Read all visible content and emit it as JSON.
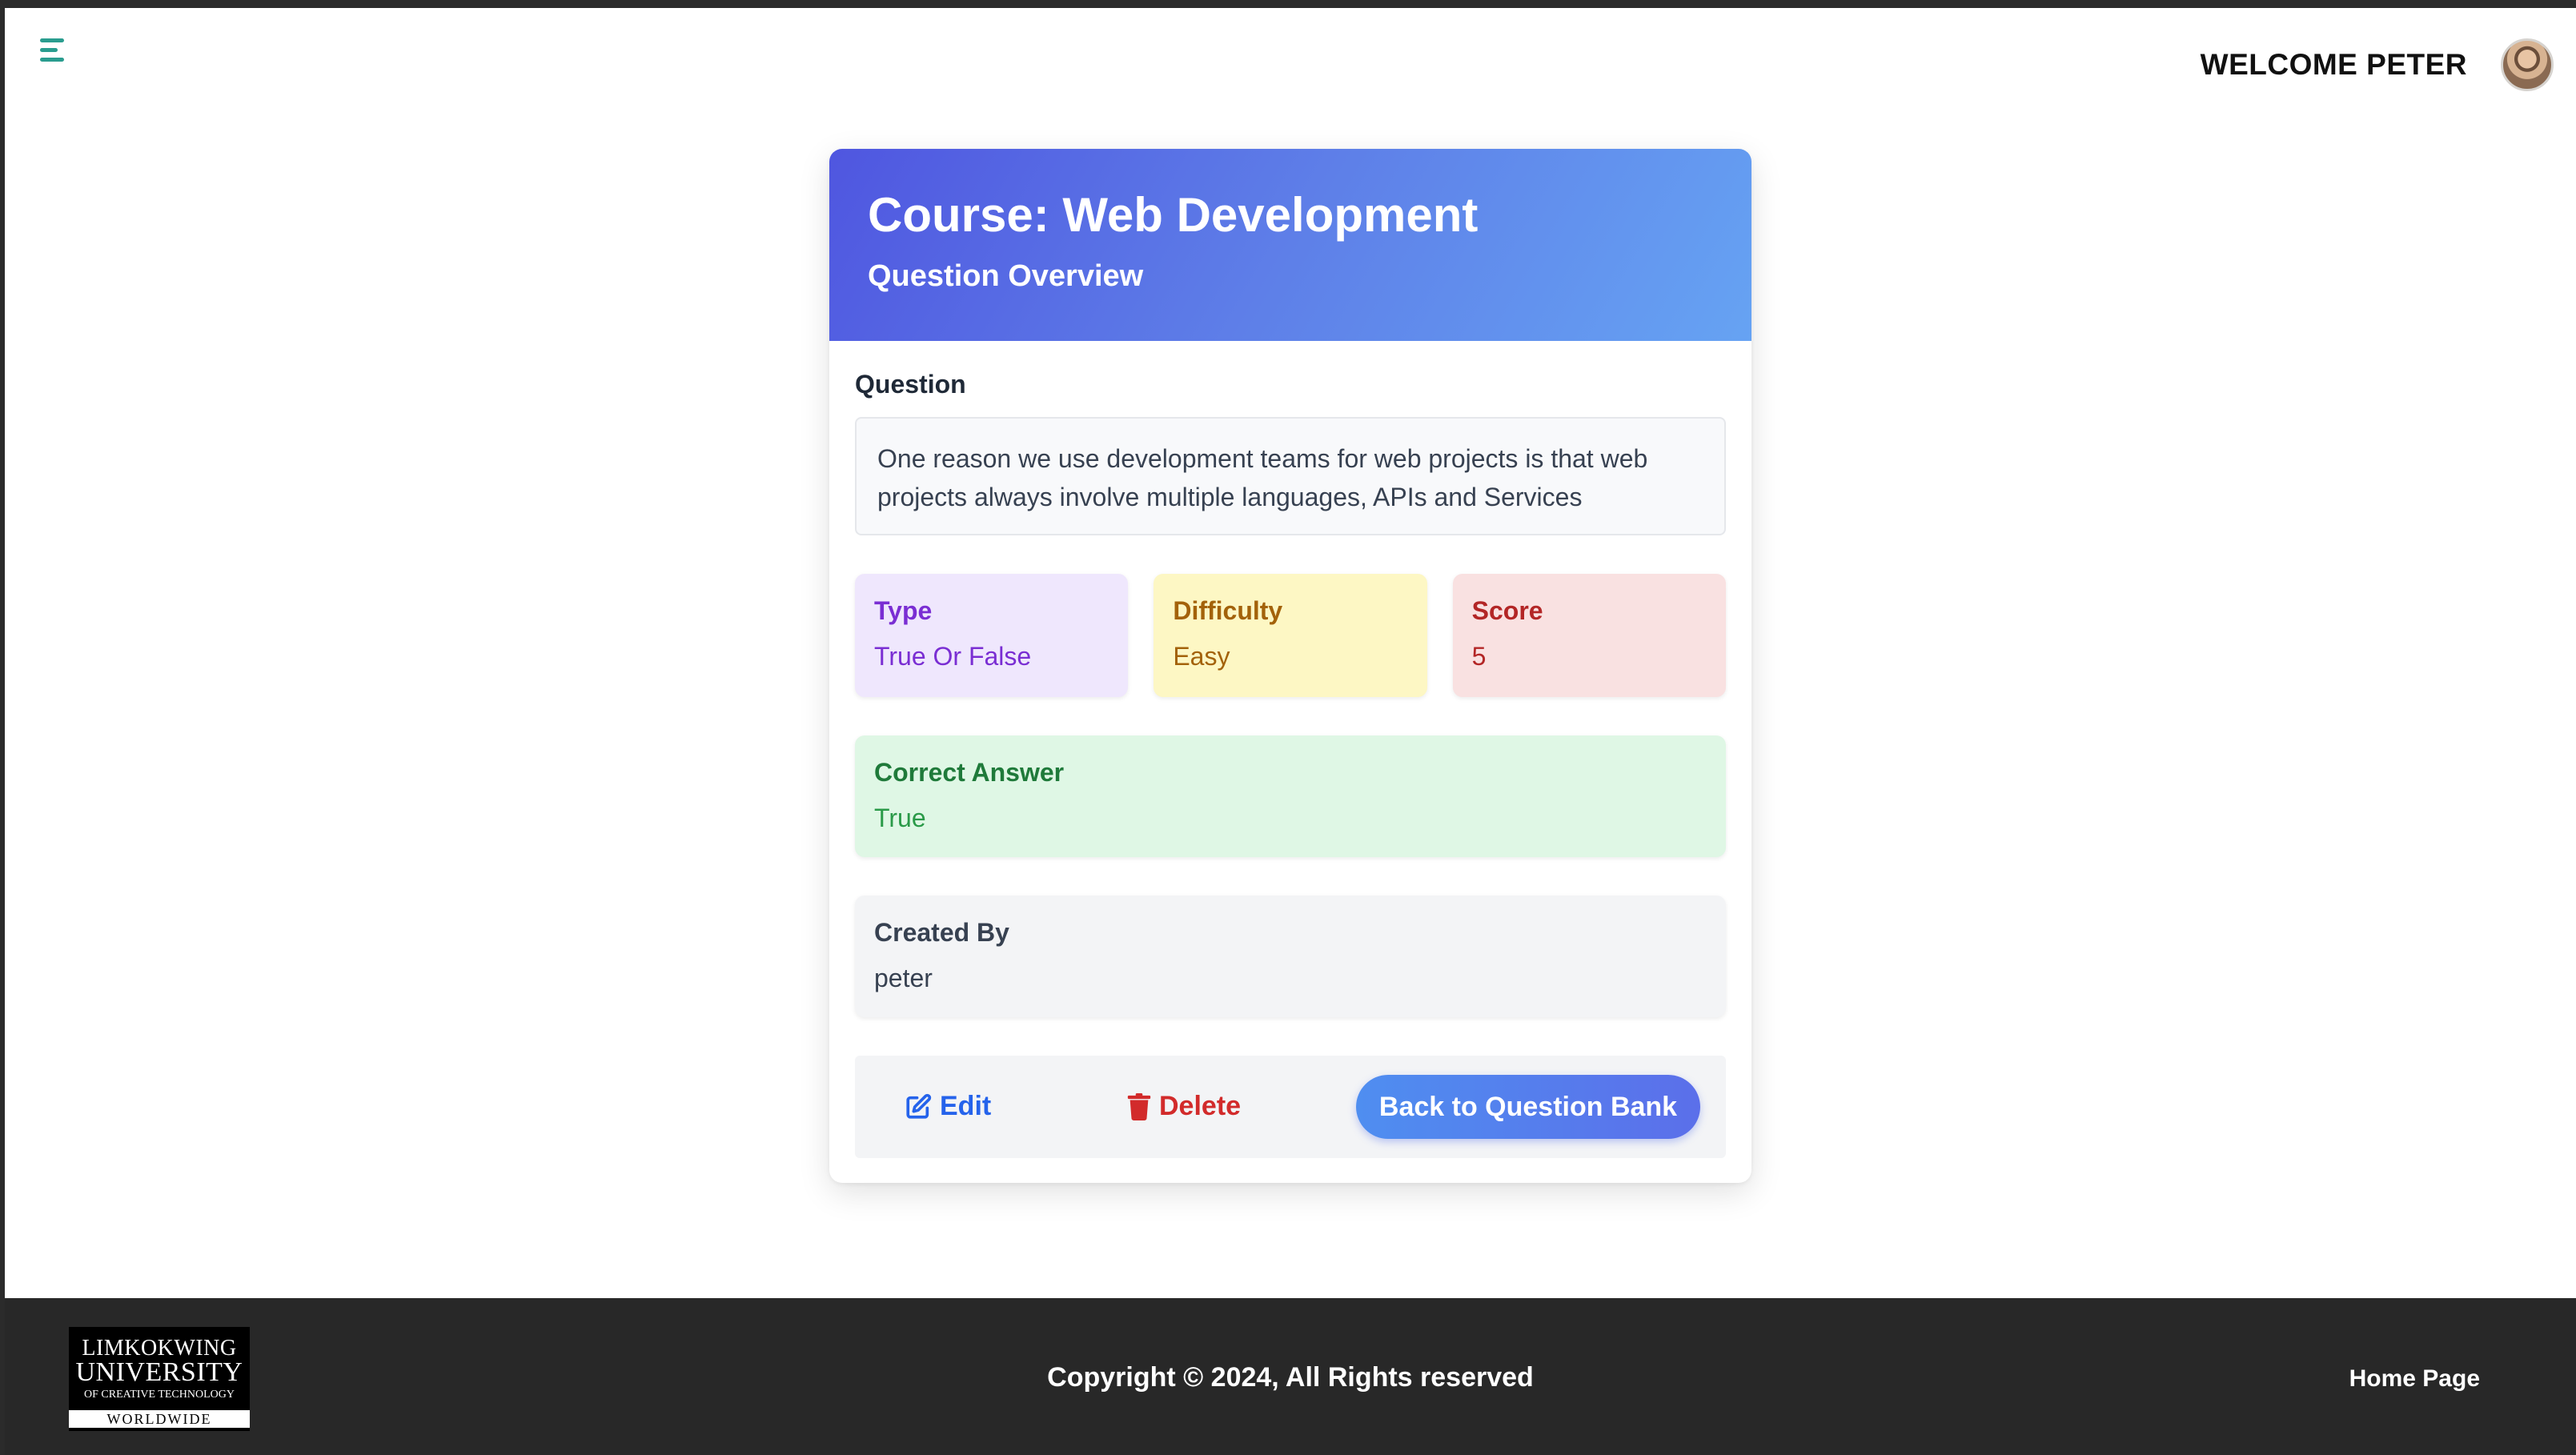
{
  "header": {
    "welcome_text": "WELCOME PETER"
  },
  "card": {
    "title": "Course: Web Development",
    "subtitle": "Question Overview",
    "question_label": "Question",
    "question_text": "One reason we use development teams for web projects is that web projects always involve multiple languages, APIs and Services",
    "type": {
      "label": "Type",
      "value": "True Or False",
      "color": "#7a2ed3"
    },
    "difficulty": {
      "label": "Difficulty",
      "value": "Easy",
      "color": "#a3620a"
    },
    "score": {
      "label": "Score",
      "value": "5",
      "color": "#b32626"
    },
    "correct_answer": {
      "label": "Correct Answer",
      "value": "True",
      "color": "#2a9a48"
    },
    "created_by": {
      "label": "Created By",
      "value": "peter"
    }
  },
  "actions": {
    "edit_label": "Edit",
    "delete_label": "Delete",
    "back_label": "Back to Question Bank"
  },
  "footer": {
    "logo_line1": "LIMKOKWING",
    "logo_line2": "UNIVERSITY",
    "logo_line3": "OF CREATIVE TECHNOLOGY",
    "logo_line4": "WORLDWIDE",
    "copyright": "Copyright © 2024, All Rights reserved",
    "home_link": "Home Page"
  },
  "icons": [
    "menu-icon",
    "avatar",
    "edit-icon",
    "trash-icon"
  ]
}
